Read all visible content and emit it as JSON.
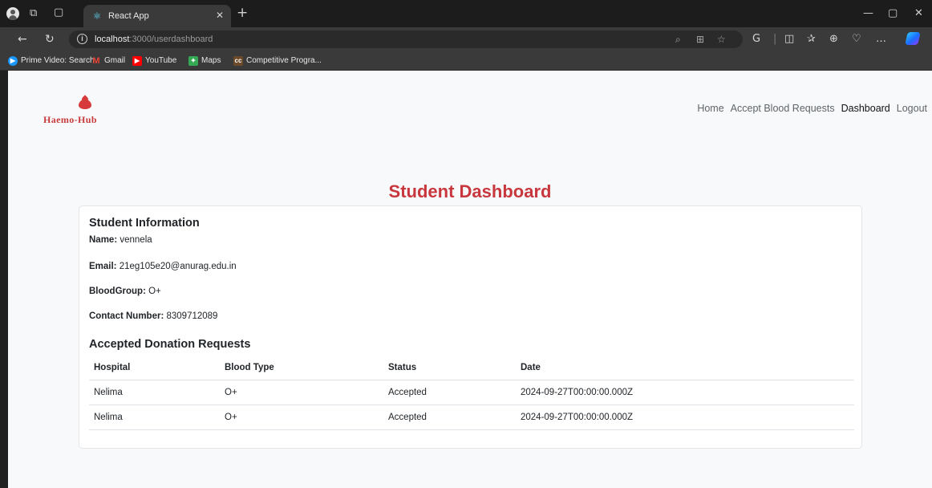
{
  "browser": {
    "tab": {
      "title": "React App"
    },
    "address": {
      "host": "localhost",
      "path": ":3000/userdashboard"
    },
    "bookmarks": [
      {
        "label": "Prime Video: Search",
        "color": "#1a98ff",
        "glyph": "▶"
      },
      {
        "label": "Gmail",
        "color": "#ea4335",
        "glyph": "M"
      },
      {
        "label": "YouTube",
        "color": "#ff0000",
        "glyph": "▶"
      },
      {
        "label": "Maps",
        "color": "#34a853",
        "glyph": "✦"
      },
      {
        "label": "Competitive Progra...",
        "color": "#6b4a2a",
        "glyph": "cc"
      }
    ],
    "icons": [
      "profile-icon",
      "workspaces-icon",
      "tab-actions-icon",
      "react-favicon-icon",
      "close-tab-icon",
      "new-tab-icon",
      "back-icon",
      "refresh-icon",
      "info-icon",
      "read-aloud-icon",
      "split-screen-icon",
      "favorite-icon",
      "extensions-icon",
      "favorites-bar-icon",
      "collections-icon",
      "browser-essentials-icon",
      "more-icon",
      "copilot-icon",
      "minimize-icon",
      "maximize-icon",
      "close-window-icon"
    ]
  },
  "header": {
    "logo_text": "Haemo-Hub",
    "brand_color": "#c73b3b",
    "nav": [
      {
        "label": "Home",
        "active": false
      },
      {
        "label": "Accept Blood Requests",
        "active": false
      },
      {
        "label": "Dashboard",
        "active": true
      },
      {
        "label": "Logout",
        "active": false
      }
    ]
  },
  "page": {
    "title": "Student Dashboard",
    "title_color": "#c8363e"
  },
  "student_info": {
    "heading": "Student Information",
    "name_label": "Name:",
    "name": "vennela",
    "email_label": "Email:",
    "email": "21eg105e20@anurag.edu.in",
    "blood_label": "BloodGroup:",
    "blood_group": "O+",
    "contact_label": "Contact Number:",
    "contact": "8309712089"
  },
  "donations": {
    "heading": "Accepted Donation Requests",
    "columns": [
      "Hospital",
      "Blood Type",
      "Status",
      "Date"
    ],
    "rows": [
      {
        "hospital": "Nelima",
        "blood_type": "O+",
        "status": "Accepted",
        "date": "2024-09-27T00:00:00.000Z"
      },
      {
        "hospital": "Nelima",
        "blood_type": "O+",
        "status": "Accepted",
        "date": "2024-09-27T00:00:00.000Z"
      }
    ]
  }
}
